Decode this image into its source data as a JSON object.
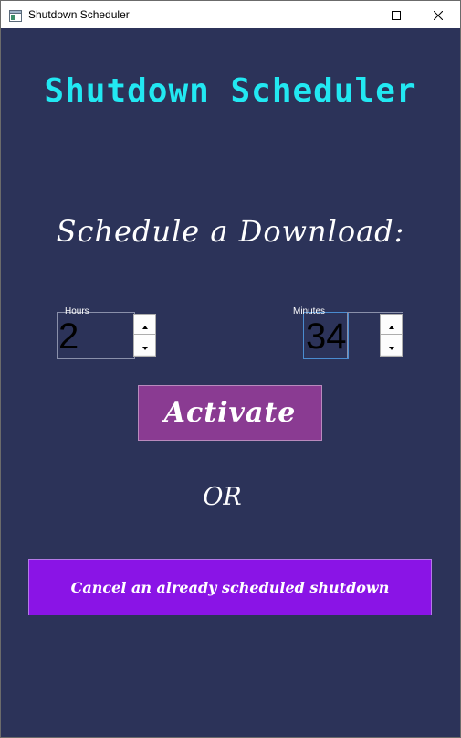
{
  "window": {
    "title": "Shutdown Scheduler",
    "icons": {
      "app": "app-window-icon",
      "minimize": "minimize-icon",
      "maximize": "maximize-icon",
      "close": "close-icon"
    }
  },
  "main": {
    "heading": "Shutdown Scheduler",
    "subheading": "Schedule a Download:",
    "hours": {
      "label": "Hours",
      "value": "2"
    },
    "minutes": {
      "label": "Minutes",
      "value": "34"
    },
    "activate_label": "Activate",
    "or_label": "OR",
    "cancel_label": "Cancel an already scheduled shutdown"
  },
  "colors": {
    "background": "#2c3359",
    "heading": "#22e8f2",
    "activate_button": "#8a3b92",
    "cancel_button": "#8a14e6"
  }
}
